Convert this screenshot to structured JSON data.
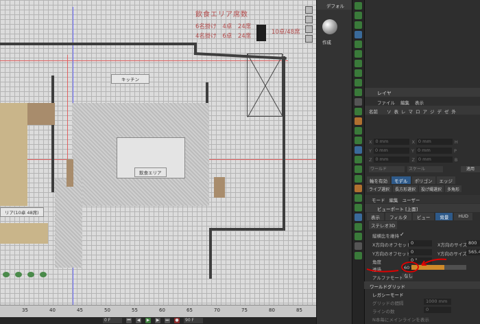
{
  "plan": {
    "title": "飲食エリア席数",
    "line1": "6名掛け　4卓　24席",
    "line2": "4名掛け　6卓　24席",
    "total": "10卓/48席",
    "room_kitchen": "キッチン",
    "room_dining": "飲食エリア",
    "side_label": "リア(10卓 48席)"
  },
  "ruler": {
    "ticks": [
      "35",
      "40",
      "45",
      "50",
      "55",
      "60",
      "65",
      "70",
      "75",
      "80",
      "85"
    ]
  },
  "timeline": {
    "start": "0 F",
    "end": "90 F"
  },
  "object_manager": {
    "header": "デフォル",
    "create_label": "作成"
  },
  "layer": {
    "title": "レイヤ",
    "menu": [
      "ファイル",
      "編集",
      "表示"
    ],
    "columns": [
      "名前",
      "ソ",
      "表",
      "レ",
      "マ",
      "ロ",
      "ア",
      "ジ",
      "デ",
      "ゼ",
      "外"
    ]
  },
  "coords": {
    "rows": [
      {
        "a": "X",
        "va": "0 mm",
        "b": "X",
        "vb": "0 mm",
        "c": "H"
      },
      {
        "a": "Y",
        "va": "0 mm",
        "b": "Y",
        "vb": "0 mm",
        "c": "P"
      },
      {
        "a": "Z",
        "va": "0 mm",
        "b": "Z",
        "vb": "0 mm",
        "c": "B"
      }
    ],
    "world": "ワールド",
    "scale": "スケール",
    "apply": "適用"
  },
  "modes": {
    "items": [
      "軸を有効",
      "モデル",
      "ポリゴン",
      "エッジ"
    ],
    "active_index": 1
  },
  "selection_tools": [
    "ライブ選択",
    "長方形選択",
    "投げ縄選択",
    "多角形"
  ],
  "attributes": {
    "menu": [
      "モード",
      "編集",
      "ユーザー"
    ],
    "title": "ビューポート [上面]",
    "tabs": [
      "表示",
      "フィルタ",
      "ビュー",
      "背景",
      "HUD"
    ],
    "active_tab": 3,
    "stereo": "ステレオ3D",
    "keep_aspect_label": "縦横比を維持",
    "keep_aspect_value": "✓",
    "x_offset_label": "X方向のオフセット",
    "x_offset_value": "0",
    "y_offset_label": "Y方向のオフセット",
    "y_offset_value": "0",
    "x_size_label": "X方向のサイズ",
    "x_size_value": "800",
    "y_size_label": "Y方向のサイズ",
    "y_size_value": "565.4",
    "rotation_label": "角度",
    "rotation_value": "0 °",
    "transparency_label": "透過",
    "transparency_value": "60 %",
    "transparency_level": 0.6,
    "alpha_label": "アルファモード",
    "alpha_value": "なし",
    "world_grid": "ワールドグリッド",
    "legacy_mode": "レガシーモード",
    "grid_spacing_label": "グリッドの間隔",
    "grid_spacing_value": "1000 mm",
    "line_count_label": "ラインの数",
    "line_count_value": "0",
    "main_line_label": "N本毎にメインラインを表示"
  },
  "colors": {
    "accent": "#2e5a8a",
    "annotation": "#e00000",
    "slider_fill": "#cf8a2a"
  }
}
